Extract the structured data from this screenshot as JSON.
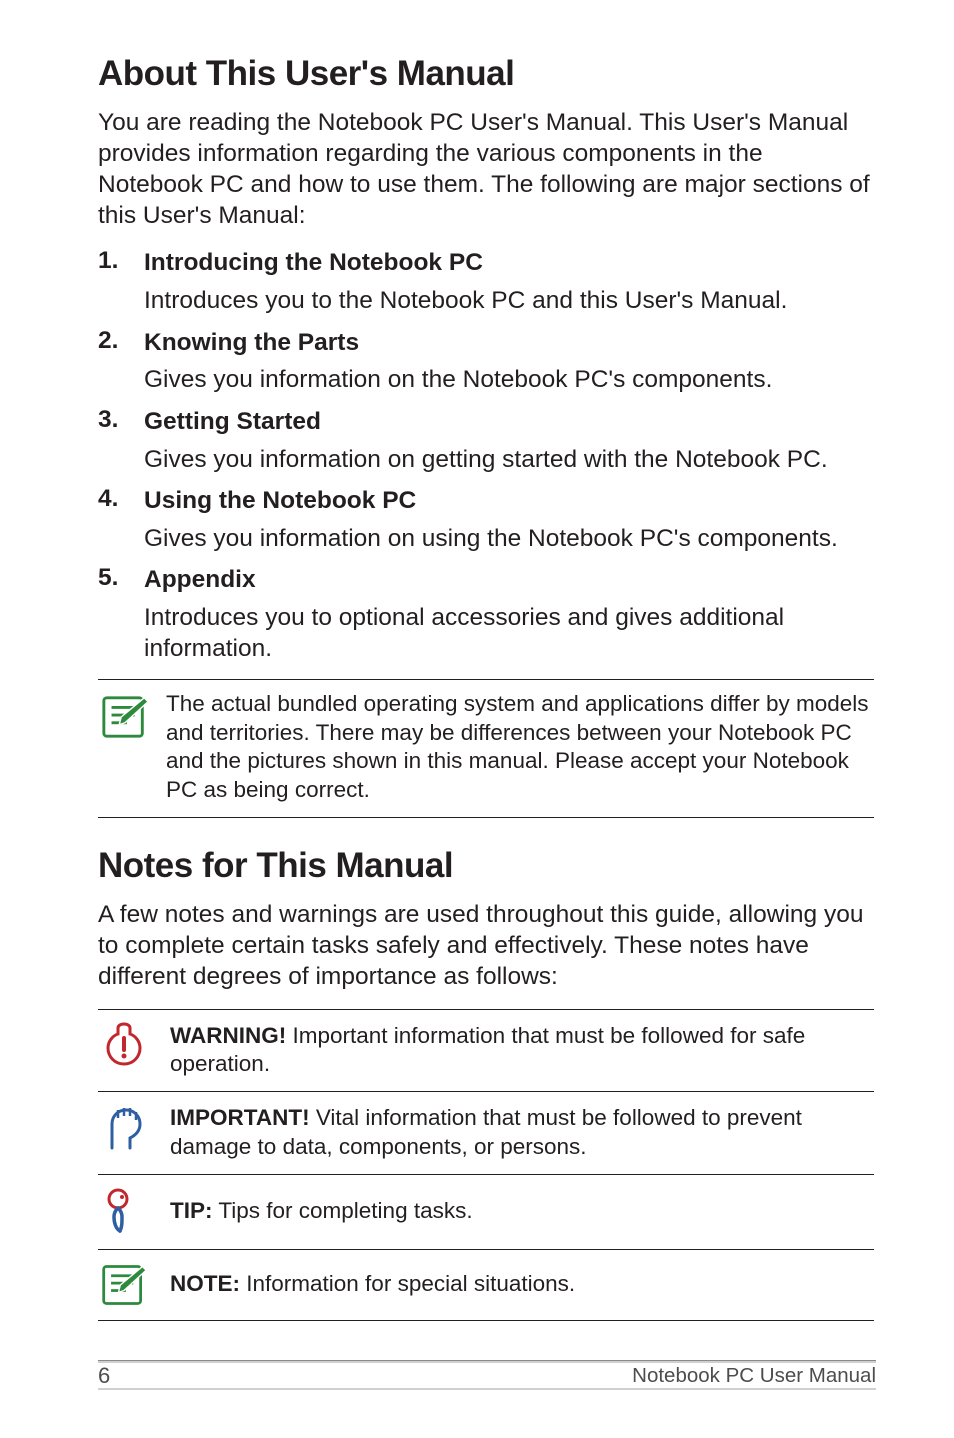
{
  "heading1": "About This User's Manual",
  "intro1": "You are reading the Notebook PC User's Manual. This User's Manual provides information regarding the various components in the Notebook PC and how to use them. The following are major sections of this User's Manual:",
  "sections": [
    {
      "title": "Introducing the Notebook PC",
      "desc": "Introduces you to the Notebook PC and this User's Manual."
    },
    {
      "title": "Knowing the Parts",
      "desc": "Gives you information on the Notebook PC's components."
    },
    {
      "title": "Getting Started",
      "desc": "Gives you information on getting started with the Notebook PC."
    },
    {
      "title": "Using the Notebook PC",
      "desc": "Gives you information on using the Notebook PC's components."
    },
    {
      "title": "Appendix",
      "desc": "Introduces you to optional accessories and gives additional information."
    }
  ],
  "note_top": "The actual bundled operating system and applications differ by models and territories. There may be differences between your Notebook PC and the pictures shown in this manual. Please accept your Notebook PC as being correct.",
  "heading2": "Notes for This Manual",
  "intro2": "A few notes and warnings are used throughout this guide, allowing you to complete certain tasks safely and effectively. These notes have different degrees of importance as follows:",
  "callouts": [
    {
      "label": "WARNING!",
      "text": " Important information that must be followed for safe operation."
    },
    {
      "label": "IMPORTANT!",
      "text": " Vital information that must be followed to prevent damage to data, components, or persons."
    },
    {
      "label": "TIP:",
      "text": " Tips for completing tasks."
    },
    {
      "label": "NOTE:",
      "text": "  Information for special situations."
    }
  ],
  "footer": {
    "page": "6",
    "label": "Notebook PC User Manual"
  }
}
